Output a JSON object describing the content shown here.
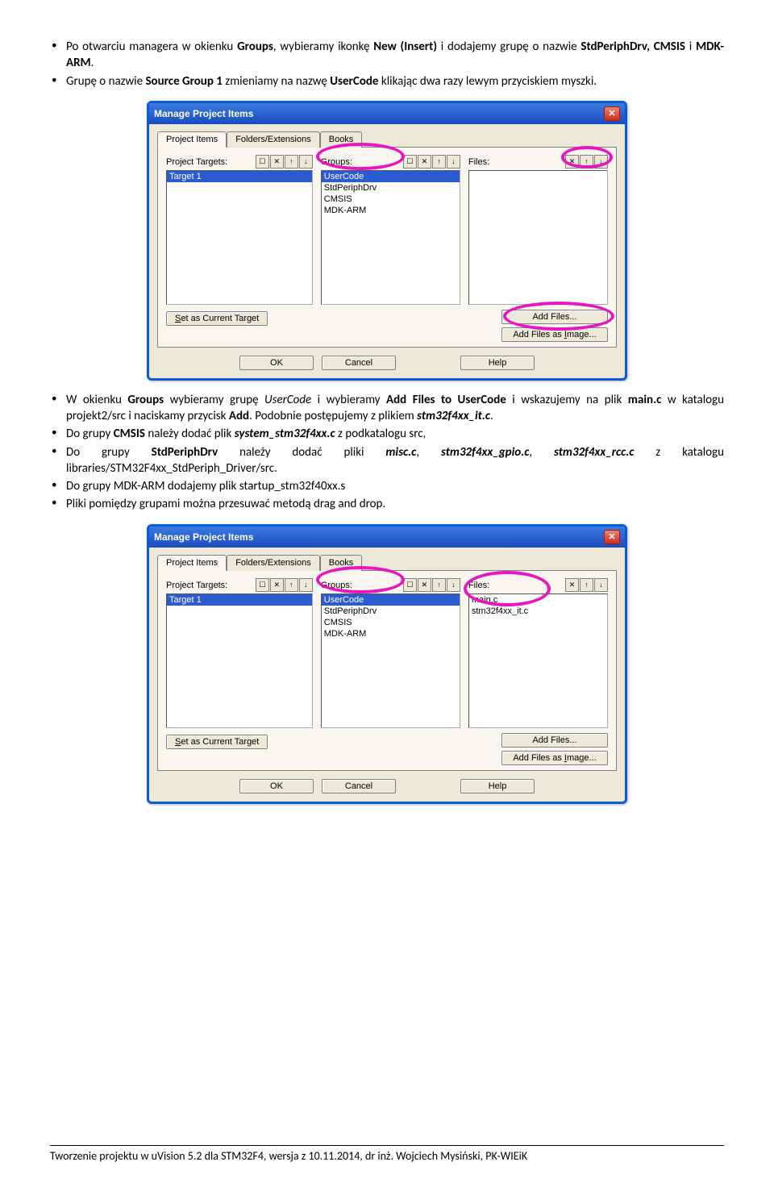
{
  "para1": [
    {
      "pre": "Po otwarciu managera w okienku ",
      "b1": "Groups",
      "mid1": ", wybieramy ikonkę  ",
      "b2": "New (Insert)",
      "mid2": " i dodajemy grupę o nazwie ",
      "b3": "StdPeriphDrv, CMSIS",
      "mid3": " i  ",
      "b4": "MDK-ARM",
      "post": "."
    },
    {
      "pre": "Grupę o nazwie ",
      "b1": "Source Group 1",
      "mid1": " zmieniamy na nazwę ",
      "b2": "UserCode",
      "post": " klikając dwa razy lewym przyciskiem myszki."
    }
  ],
  "para2": [
    {
      "pre": "W okienku ",
      "b1": "Groups",
      "mid1": " wybieramy  grupę ",
      "i1": "UserCode ",
      "mid2": " i wybieramy ",
      "b2": "Add Files to UserCode",
      "mid3": " i wskazujemy na plik ",
      "b3": "main.c",
      "mid4": " w katalogu projekt2/src i naciskamy przycisk ",
      "b4": "Add",
      "mid5": ". Podobnie postępujemy z plikiem ",
      "bi1": "stm32f4xx_it.c",
      "post": "."
    },
    {
      "pre": "Do grupy ",
      "b1": "CMSIS",
      "mid1": " należy dodać plik ",
      "bi1": "system_stm32f4xx.c",
      "post": " z podkatalogu src,"
    },
    {
      "pre": "Do grupy ",
      "b1": "StdPeriphDrv",
      "mid1": " należy dodać pliki ",
      "bi1": "misc.c",
      "mid2": ", ",
      "bi2": "stm32f4xx_gpio.c",
      "mid3": ", ",
      "bi3": "stm32f4xx_rcc.c",
      "post": " z katalogu libraries/STM32F4xx_StdPeriph_Driver/src."
    },
    {
      "text": "Do grupy MDK-ARM dodajemy plik startup_stm32f40xx.s"
    },
    {
      "text": "Pliki pomiędzy grupami można przesuwać  metodą drag and drop."
    }
  ],
  "dlg": {
    "title": "Manage Project Items",
    "tabs": [
      "Project Items",
      "Folders/Extensions",
      "Books"
    ],
    "h1": "Project Targets:",
    "h2": "Groups:",
    "h3": "Files:",
    "targets": [
      "Target 1"
    ],
    "groups": [
      "UserCode",
      "StdPeriphDrv",
      "CMSIS",
      "MDK-ARM"
    ],
    "files2": [
      "main.c",
      "stm32f4xx_it.c"
    ],
    "setTarget": "Set as Current Target",
    "addFiles": "Add Files...",
    "addImage": "Add Files as Image...",
    "ok": "OK",
    "cancel": "Cancel",
    "help": "Help"
  },
  "footer": "Tworzenie projektu w uVision 5.2 dla STM32F4,  wersja z 10.11.2014, dr inż. Wojciech Mysiński, PK-WIEiK"
}
